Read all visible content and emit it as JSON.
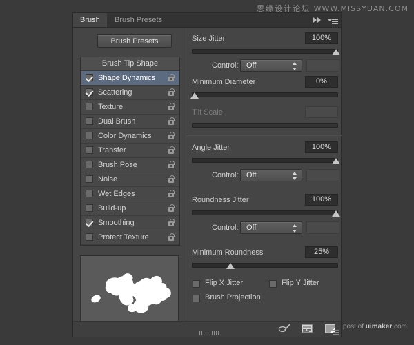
{
  "watermark": {
    "zh": "思缘设计论坛",
    "url": "WWW.MISSYUAN.COM",
    "credit_prefix": "post of ",
    "credit_brand": "uimaker",
    "credit_suffix": ".com"
  },
  "panel": {
    "tabs": [
      {
        "label": "Brush",
        "active": true
      },
      {
        "label": "Brush Presets",
        "active": false
      }
    ],
    "collapse_icon": "double-arrow-icon",
    "menu_icon": "panel-menu-icon"
  },
  "sidebar": {
    "presets_button": "Brush Presets",
    "header": "Brush Tip Shape",
    "items": [
      {
        "label": "Shape Dynamics",
        "checked": true,
        "selected": true,
        "locked": false
      },
      {
        "label": "Scattering",
        "checked": true,
        "selected": false,
        "locked": false
      },
      {
        "label": "Texture",
        "checked": false,
        "selected": false,
        "locked": false
      },
      {
        "label": "Dual Brush",
        "checked": false,
        "selected": false,
        "locked": false
      },
      {
        "label": "Color Dynamics",
        "checked": false,
        "selected": false,
        "locked": false
      },
      {
        "label": "Transfer",
        "checked": false,
        "selected": false,
        "locked": false
      },
      {
        "label": "Brush Pose",
        "checked": false,
        "selected": false,
        "locked": false
      },
      {
        "label": "Noise",
        "checked": false,
        "selected": false,
        "locked": false
      },
      {
        "label": "Wet Edges",
        "checked": false,
        "selected": false,
        "locked": false
      },
      {
        "label": "Build-up",
        "checked": false,
        "selected": false,
        "locked": false
      },
      {
        "label": "Smoothing",
        "checked": true,
        "selected": false,
        "locked": false
      },
      {
        "label": "Protect Texture",
        "checked": false,
        "selected": false,
        "locked": false
      }
    ],
    "preview_name": "brush-stroke-preview"
  },
  "controls": {
    "size_jitter": {
      "label": "Size Jitter",
      "value": "100%",
      "slider_pct": 100
    },
    "size_control": {
      "label": "Control:",
      "value": "Off",
      "side_value": ""
    },
    "minimum_diameter": {
      "label": "Minimum Diameter",
      "value": "0%",
      "slider_pct": 0
    },
    "tilt_scale": {
      "label": "Tilt Scale",
      "value": "",
      "slider_pct": 0,
      "disabled": true
    },
    "angle_jitter": {
      "label": "Angle Jitter",
      "value": "100%",
      "slider_pct": 100
    },
    "angle_control": {
      "label": "Control:",
      "value": "Off",
      "side_value": ""
    },
    "roundness_jitter": {
      "label": "Roundness Jitter",
      "value": "100%",
      "slider_pct": 100
    },
    "roundness_control": {
      "label": "Control:",
      "value": "Off",
      "side_value": ""
    },
    "minimum_roundness": {
      "label": "Minimum Roundness",
      "value": "25%",
      "slider_pct": 25
    },
    "flip_x_jitter": {
      "label": "Flip X Jitter",
      "checked": false
    },
    "flip_y_jitter": {
      "label": "Flip Y Jitter",
      "checked": false
    },
    "brush_projection": {
      "label": "Brush Projection",
      "checked": false
    }
  },
  "footer": {
    "icons": [
      "toggle-brush-dynamics-icon",
      "brush-panel-icon",
      "new-brush-icon"
    ]
  },
  "colors": {
    "panel_bg": "#454545",
    "tab_bg": "#333333",
    "selection": "#5c6b80",
    "value_box": "#2e2e2e",
    "text": "#cfcfcf"
  }
}
